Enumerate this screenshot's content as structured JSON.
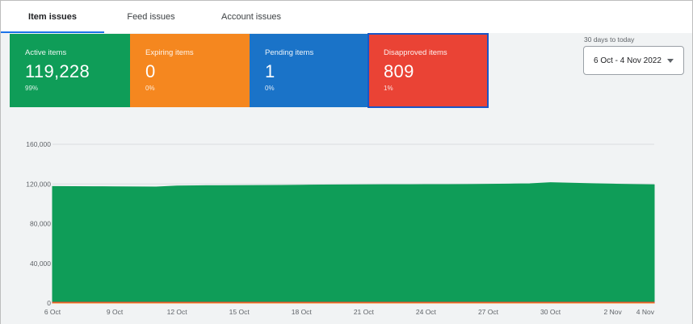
{
  "tabs": [
    {
      "label": "Item issues",
      "active": true
    },
    {
      "label": "Feed issues",
      "active": false
    },
    {
      "label": "Account issues",
      "active": false
    }
  ],
  "cards": {
    "active": {
      "label": "Active items",
      "value": "119,228",
      "percent": "99%",
      "color": "#0f9d58"
    },
    "expiring": {
      "label": "Expiring items",
      "value": "0",
      "percent": "0%",
      "color": "#f5871f"
    },
    "pending": {
      "label": "Pending items",
      "value": "1",
      "percent": "0%",
      "color": "#1a73c8"
    },
    "disapproved": {
      "label": "Disapproved items",
      "value": "809",
      "percent": "1%",
      "color": "#ea4335",
      "selected": true
    }
  },
  "date_range": {
    "caption": "30 days to today",
    "value": "6 Oct - 4 Nov 2022",
    "icon": "dropdown-caret-icon"
  },
  "chart_data": {
    "type": "area",
    "title": "",
    "xlabel": "",
    "ylabel": "",
    "ylim": [
      0,
      160000
    ],
    "y_ticks": [
      "0",
      "40,000",
      "80,000",
      "120,000",
      "160,000"
    ],
    "y_tick_values": [
      0,
      40000,
      80000,
      120000,
      160000
    ],
    "x_tick_labels": [
      "6 Oct",
      "9 Oct",
      "12 Oct",
      "15 Oct",
      "18 Oct",
      "21 Oct",
      "24 Oct",
      "27 Oct",
      "30 Oct",
      "2 Nov",
      "4 Nov"
    ],
    "x_tick_index": [
      0,
      3,
      6,
      9,
      12,
      15,
      18,
      21,
      24,
      27,
      29
    ],
    "grid": true,
    "legend": "none",
    "categories": [
      "6 Oct",
      "7 Oct",
      "8 Oct",
      "9 Oct",
      "10 Oct",
      "11 Oct",
      "12 Oct",
      "13 Oct",
      "14 Oct",
      "15 Oct",
      "16 Oct",
      "17 Oct",
      "18 Oct",
      "19 Oct",
      "20 Oct",
      "21 Oct",
      "22 Oct",
      "23 Oct",
      "24 Oct",
      "25 Oct",
      "26 Oct",
      "27 Oct",
      "28 Oct",
      "29 Oct",
      "30 Oct",
      "31 Oct",
      "1 Nov",
      "2 Nov",
      "3 Nov",
      "4 Nov"
    ],
    "series": [
      {
        "name": "Active items",
        "color": "#0f9d58",
        "values": [
          117500,
          117400,
          117300,
          117200,
          117100,
          117000,
          118000,
          118200,
          118300,
          118400,
          118500,
          118600,
          118800,
          119000,
          119100,
          119200,
          119300,
          119300,
          119400,
          119400,
          119500,
          119700,
          119900,
          120200,
          121300,
          120800,
          120300,
          119900,
          119500,
          119228
        ]
      },
      {
        "name": "Disapproved items",
        "color": "#ea4335",
        "values": [
          820,
          815,
          812,
          810,
          810,
          808,
          812,
          815,
          815,
          812,
          810,
          810,
          808,
          808,
          810,
          810,
          809,
          809,
          809,
          810,
          810,
          810,
          809,
          809,
          812,
          810,
          810,
          809,
          809,
          809
        ]
      },
      {
        "name": "Expiring items",
        "color": "#f5871f",
        "values": [
          0,
          0,
          0,
          0,
          0,
          0,
          0,
          0,
          0,
          0,
          0,
          0,
          0,
          0,
          0,
          0,
          0,
          0,
          0,
          0,
          0,
          0,
          0,
          0,
          0,
          0,
          0,
          0,
          0,
          0
        ]
      }
    ]
  }
}
